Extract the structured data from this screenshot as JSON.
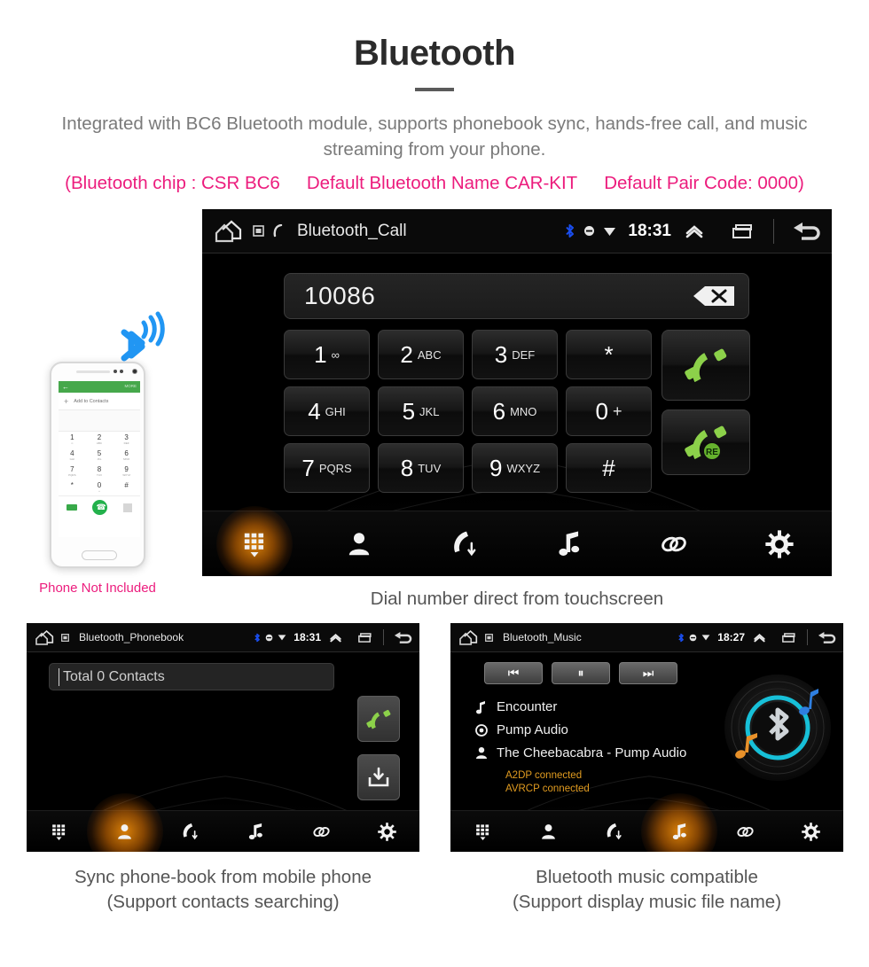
{
  "header": {
    "title": "Bluetooth",
    "intro": "Integrated with BC6 Bluetooth module, supports phonebook sync, hands-free call, and music streaming from your phone.",
    "spec_chip": "(Bluetooth chip : CSR BC6",
    "spec_name": "Default Bluetooth Name CAR-KIT",
    "spec_pair": "Default Pair Code: 0000)",
    "accent_pink": "#ec1c7d",
    "body_gray": "#7a7a7a"
  },
  "dial_screen": {
    "statusbar": {
      "title": "Bluetooth_Call",
      "time": "18:31",
      "icons": [
        "home-icon",
        "screenshot-icon",
        "call-icon",
        "bluetooth-icon",
        "mute-icon",
        "wifi-icon",
        "chevron-up-icon",
        "recents-icon",
        "back-icon"
      ],
      "bluetooth_color": "#1a4ef0"
    },
    "input": {
      "value": "10086",
      "backspace_label": "backspace-icon"
    },
    "keys": [
      {
        "num": "1",
        "sub": "∞",
        "name": "key-1"
      },
      {
        "num": "2",
        "sub": "ABC",
        "name": "key-2"
      },
      {
        "num": "3",
        "sub": "DEF",
        "name": "key-3"
      },
      {
        "num": "*",
        "sub": "",
        "name": "key-star"
      },
      {
        "num": "4",
        "sub": "GHI",
        "name": "key-4"
      },
      {
        "num": "5",
        "sub": "JKL",
        "name": "key-5"
      },
      {
        "num": "6",
        "sub": "MNO",
        "name": "key-6"
      },
      {
        "num": "0",
        "sub": "+",
        "name": "key-0"
      },
      {
        "num": "7",
        "sub": "PQRS",
        "name": "key-7"
      },
      {
        "num": "8",
        "sub": "TUV",
        "name": "key-8"
      },
      {
        "num": "9",
        "sub": "WXYZ",
        "name": "key-9"
      },
      {
        "num": "#",
        "sub": "",
        "name": "key-hash"
      }
    ],
    "call_button": "call-icon",
    "redial_button": "redial-icon",
    "redial_badge": "RE",
    "nav": [
      {
        "label": "keypad",
        "icon": "keypad-icon",
        "active": true
      },
      {
        "label": "contacts",
        "icon": "contacts-icon",
        "active": false
      },
      {
        "label": "call history",
        "icon": "call-history-icon",
        "active": false
      },
      {
        "label": "music",
        "icon": "music-note-icon",
        "active": false
      },
      {
        "label": "pair",
        "icon": "link-icon",
        "active": false
      },
      {
        "label": "settings",
        "icon": "gear-icon",
        "active": false
      }
    ],
    "caption": "Dial number direct from touchscreen"
  },
  "phone_mockup": {
    "appbar_label": "MORE",
    "add_contacts": "Add to Contacts",
    "keys": [
      {
        "n": "1",
        "s": "∞"
      },
      {
        "n": "2",
        "s": "ABC"
      },
      {
        "n": "3",
        "s": "DEF"
      },
      {
        "n": "4",
        "s": "GHI"
      },
      {
        "n": "5",
        "s": "JKL"
      },
      {
        "n": "6",
        "s": "MNO"
      },
      {
        "n": "7",
        "s": "PQRS"
      },
      {
        "n": "8",
        "s": "TUV"
      },
      {
        "n": "9",
        "s": "WXYZ"
      },
      {
        "n": "*",
        "s": ""
      },
      {
        "n": "0",
        "s": "+"
      },
      {
        "n": "#",
        "s": ""
      }
    ],
    "note": "Phone Not Included"
  },
  "phonebook_screen": {
    "statusbar": {
      "title": "Bluetooth_Phonebook",
      "time": "18:31"
    },
    "search_value": "Total 0 Contacts",
    "call_button": "call-icon",
    "download_button": "download-contacts-icon",
    "nav": [
      {
        "label": "keypad",
        "icon": "keypad-icon",
        "active": false
      },
      {
        "label": "contacts",
        "icon": "contacts-icon",
        "active": true
      },
      {
        "label": "call history",
        "icon": "call-history-icon",
        "active": false
      },
      {
        "label": "music",
        "icon": "music-note-icon",
        "active": false
      },
      {
        "label": "pair",
        "icon": "link-icon",
        "active": false
      },
      {
        "label": "settings",
        "icon": "gear-icon",
        "active": false
      }
    ],
    "caption_line1": "Sync phone-book from mobile phone",
    "caption_line2": "(Support contacts searching)"
  },
  "music_screen": {
    "statusbar": {
      "title": "Bluetooth_Music",
      "time": "18:27"
    },
    "transport": [
      {
        "label": "previous",
        "icon": "prev-track-icon",
        "glyph": "⏮"
      },
      {
        "label": "pause",
        "icon": "pause-icon",
        "glyph": "⏸"
      },
      {
        "label": "next",
        "icon": "next-track-icon",
        "glyph": "⏭"
      }
    ],
    "meta": [
      {
        "icon": "music-note-icon",
        "text": "Encounter"
      },
      {
        "icon": "album-icon",
        "text": "Pump Audio"
      },
      {
        "icon": "artist-icon",
        "text": "The Cheebacabra - Pump Audio"
      }
    ],
    "status_lines": [
      "A2DP connected",
      "AVRCP connected"
    ],
    "status_color": "#e09b20",
    "art_accent": "#17c0d8",
    "nav": [
      {
        "label": "keypad",
        "icon": "keypad-icon",
        "active": false
      },
      {
        "label": "contacts",
        "icon": "contacts-icon",
        "active": false
      },
      {
        "label": "call history",
        "icon": "call-history-icon",
        "active": false
      },
      {
        "label": "music",
        "icon": "music-note-icon",
        "active": true
      },
      {
        "label": "pair",
        "icon": "link-icon",
        "active": false
      },
      {
        "label": "settings",
        "icon": "gear-icon",
        "active": false
      }
    ],
    "caption_line1": "Bluetooth music compatible",
    "caption_line2": "(Support display music file name)"
  }
}
